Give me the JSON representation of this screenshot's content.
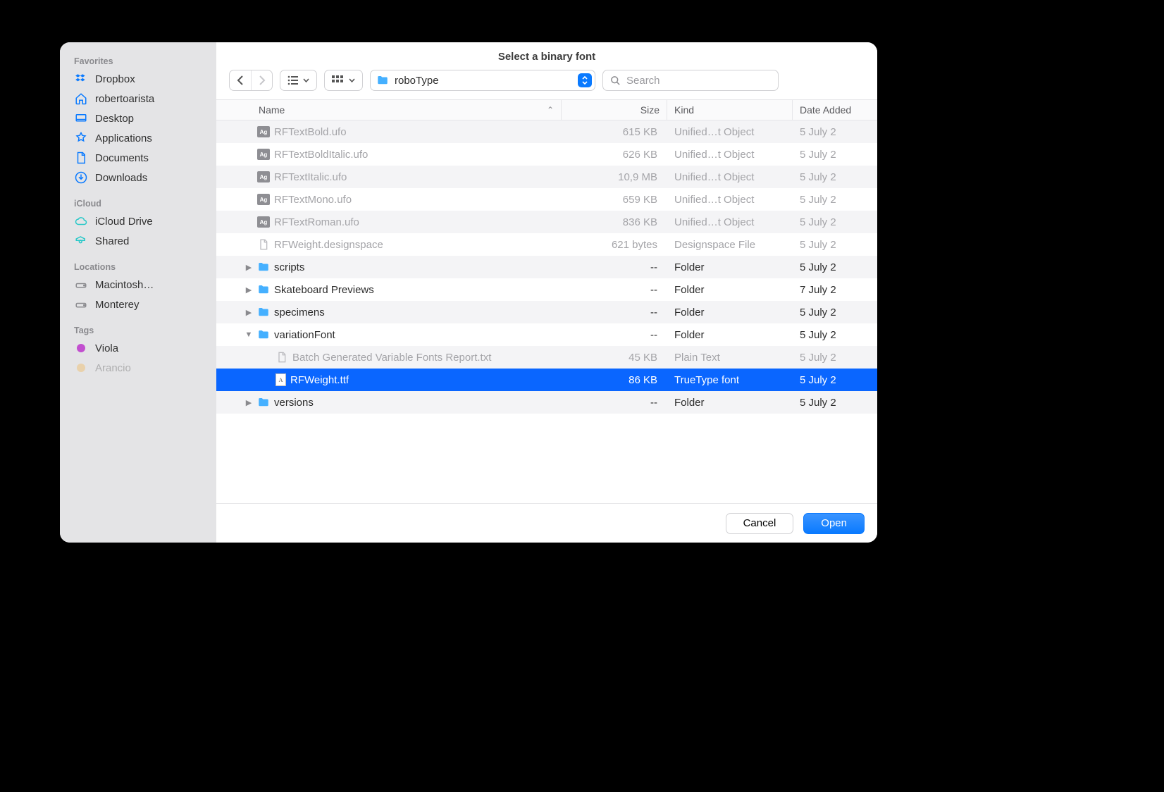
{
  "title": "Select a binary font",
  "path_label": "roboType",
  "search_placeholder": "Search",
  "sidebar": {
    "sections": [
      {
        "label": "Favorites",
        "items": [
          {
            "label": "Dropbox",
            "icon": "dropbox"
          },
          {
            "label": "robertoarista",
            "icon": "home"
          },
          {
            "label": "Desktop",
            "icon": "desktop"
          },
          {
            "label": "Applications",
            "icon": "apps"
          },
          {
            "label": "Documents",
            "icon": "doc"
          },
          {
            "label": "Downloads",
            "icon": "download"
          }
        ]
      },
      {
        "label": "iCloud",
        "items": [
          {
            "label": "iCloud Drive",
            "icon": "cloud"
          },
          {
            "label": "Shared",
            "icon": "shared"
          }
        ]
      },
      {
        "label": "Locations",
        "items": [
          {
            "label": "Macintosh…",
            "icon": "disk"
          },
          {
            "label": "Monterey",
            "icon": "disk"
          }
        ]
      },
      {
        "label": "Tags",
        "items": [
          {
            "label": "Viola",
            "icon": "tag-purple"
          },
          {
            "label": "Arancio",
            "icon": "tag-orange"
          }
        ]
      }
    ]
  },
  "columns": {
    "name": "Name",
    "size": "Size",
    "kind": "Kind",
    "date": "Date Added"
  },
  "rows": [
    {
      "name": "RFTextBold.ufo",
      "size": "615 KB",
      "kind": "Unified…t Object",
      "date": "5 July 2",
      "type": "ufo",
      "dim": true,
      "indent": 0
    },
    {
      "name": "RFTextBoldItalic.ufo",
      "size": "626 KB",
      "kind": "Unified…t Object",
      "date": "5 July 2",
      "type": "ufo",
      "dim": true,
      "indent": 0
    },
    {
      "name": "RFTextItalic.ufo",
      "size": "10,9 MB",
      "kind": "Unified…t Object",
      "date": "5 July 2",
      "type": "ufo",
      "dim": true,
      "indent": 0
    },
    {
      "name": "RFTextMono.ufo",
      "size": "659 KB",
      "kind": "Unified…t Object",
      "date": "5 July 2",
      "type": "ufo",
      "dim": true,
      "indent": 0
    },
    {
      "name": "RFTextRoman.ufo",
      "size": "836 KB",
      "kind": "Unified…t Object",
      "date": "5 July 2",
      "type": "ufo",
      "dim": true,
      "indent": 0
    },
    {
      "name": "RFWeight.designspace",
      "size": "621 bytes",
      "kind": "Designspace File",
      "date": "5 July 2",
      "type": "doc",
      "dim": true,
      "indent": 0
    },
    {
      "name": "scripts",
      "size": "--",
      "kind": "Folder",
      "date": "5 July 2",
      "type": "folder",
      "indent": 0,
      "disclosure": "closed"
    },
    {
      "name": "Skateboard Previews",
      "size": "--",
      "kind": "Folder",
      "date": "7 July 2",
      "type": "folder",
      "indent": 0,
      "disclosure": "closed"
    },
    {
      "name": "specimens",
      "size": "--",
      "kind": "Folder",
      "date": "5 July 2",
      "type": "folder",
      "indent": 0,
      "disclosure": "closed"
    },
    {
      "name": "variationFont",
      "size": "--",
      "kind": "Folder",
      "date": "5 July 2",
      "type": "folder",
      "indent": 0,
      "disclosure": "open"
    },
    {
      "name": "Batch Generated Variable Fonts Report.txt",
      "size": "45 KB",
      "kind": "Plain Text",
      "date": "5 July 2",
      "type": "doc",
      "dim": true,
      "indent": 1
    },
    {
      "name": "RFWeight.ttf",
      "size": "86 KB",
      "kind": "TrueType font",
      "date": "5 July 2",
      "type": "ttf",
      "indent": 1,
      "selected": true
    },
    {
      "name": "versions",
      "size": "--",
      "kind": "Folder",
      "date": "5 July 2",
      "type": "folder",
      "indent": 0,
      "disclosure": "closed"
    }
  ],
  "footer": {
    "cancel": "Cancel",
    "open": "Open"
  }
}
